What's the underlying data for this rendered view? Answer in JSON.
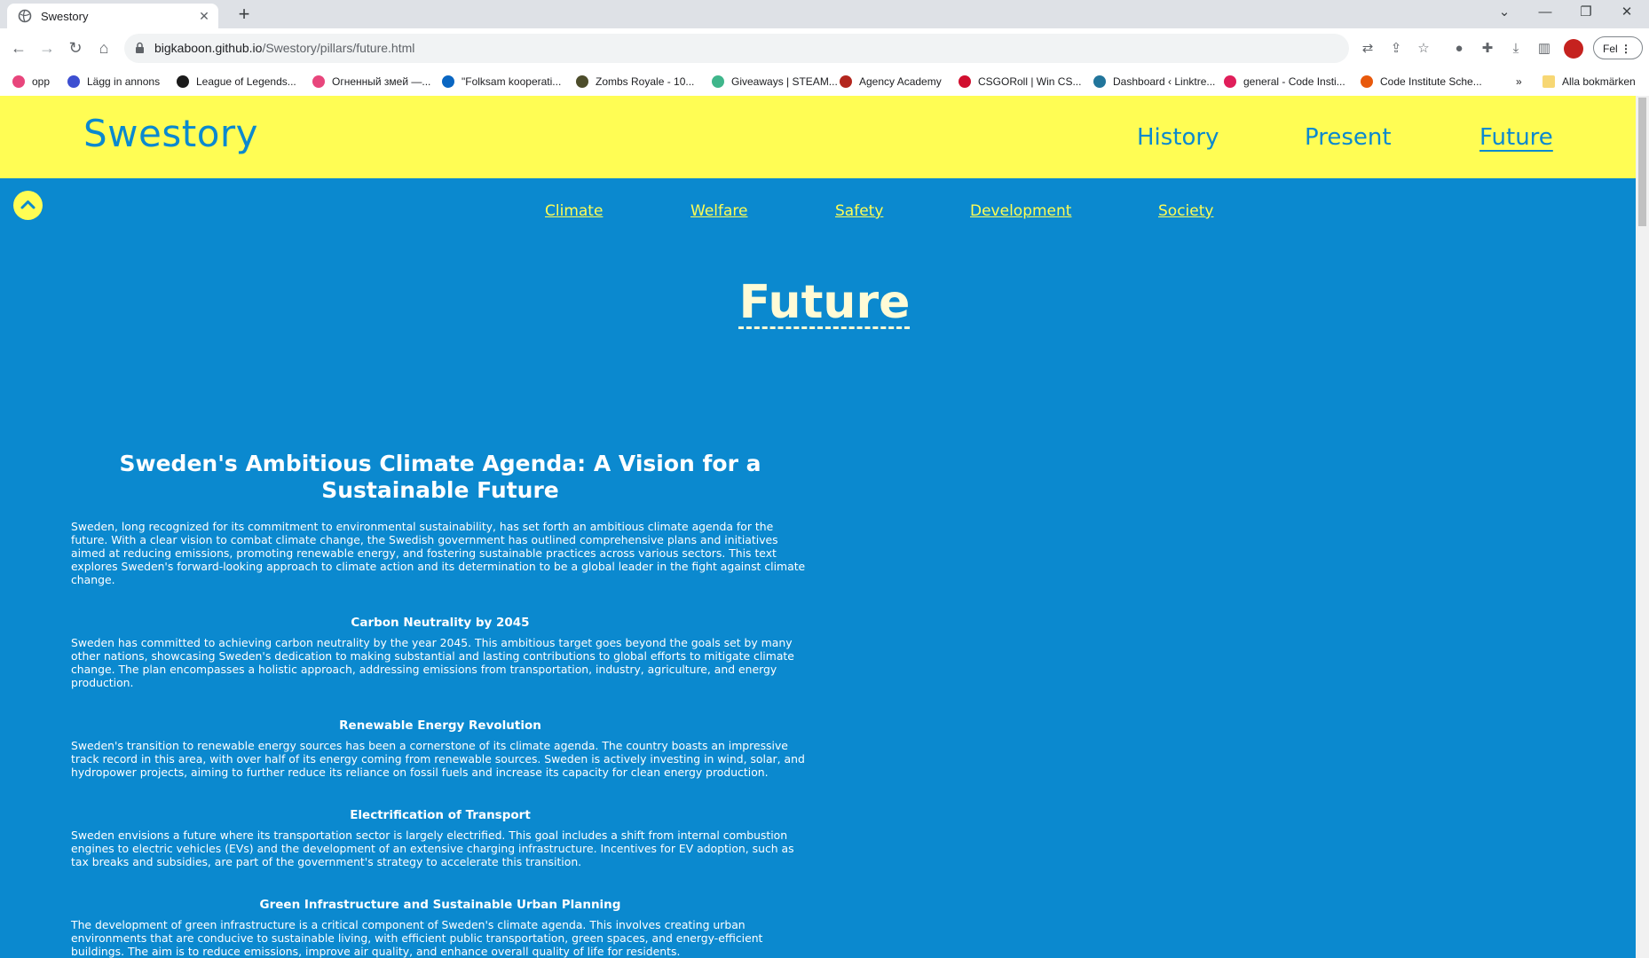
{
  "browser": {
    "tab_title": "Swestory",
    "url_host": "bigkaboon.github.io",
    "url_path": "/Swestory/pillars/future.html",
    "profile_button": "Fel",
    "bookmarks": [
      {
        "label": "opp",
        "icon": "swoosh-icon",
        "color": "#e8467c"
      },
      {
        "label": "Lägg in annons",
        "icon": "circle-s-icon",
        "color": "#3d4fd1"
      },
      {
        "label": "League of Legends...",
        "icon": "lol-icon",
        "color": "#1b1b1b"
      },
      {
        "label": "Огненный змей —...",
        "icon": "swoosh-icon",
        "color": "#e8467c"
      },
      {
        "label": "\"Folksam kooperati...",
        "icon": "linkedin-icon",
        "color": "#0a66c2"
      },
      {
        "label": "Zombs Royale - 10...",
        "icon": "zombs-icon",
        "color": "#4d4d2b"
      },
      {
        "label": "Giveaways | STEAM...",
        "icon": "steam-icon",
        "color": "#3fb68b"
      },
      {
        "label": "Agency Academy",
        "icon": "red-circle-icon",
        "color": "#b3261e"
      },
      {
        "label": "CSGORoll | Win CS...",
        "icon": "csgoroll-icon",
        "color": "#d10f2f"
      },
      {
        "label": "Dashboard ‹ Linktre...",
        "icon": "wordpress-icon",
        "color": "#21759b"
      },
      {
        "label": "general - Code Insti...",
        "icon": "slack-icon",
        "color": "#e01e5a"
      },
      {
        "label": "Code Institute Sche...",
        "icon": "circle-o-icon",
        "color": "#e8590c"
      }
    ],
    "bookmarks_more": "»",
    "all_bookmarks": "Alla bokmärken"
  },
  "site": {
    "brand": "Swestory",
    "nav": [
      "History",
      "Present",
      "Future"
    ],
    "subnav": [
      "Climate",
      "Welfare",
      "Safety",
      "Development",
      "Society"
    ],
    "hero_title": "Future",
    "colors": {
      "primary": "#0b89cf",
      "accent": "#fffd54",
      "hero_text": "#fffbd6"
    }
  },
  "article": {
    "title": "Sweden's Ambitious Climate Agenda: A Vision for a Sustainable Future",
    "intro": "Sweden, long recognized for its commitment to environmental sustainability, has set forth an ambitious climate agenda for the future. With a clear vision to combat climate change, the Swedish government has outlined comprehensive plans and initiatives aimed at reducing emissions, promoting renewable energy, and fostering sustainable practices across various sectors. This text explores Sweden's forward-looking approach to climate action and its determination to be a global leader in the fight against climate change.",
    "sections": [
      {
        "heading": "Carbon Neutrality by 2045",
        "body": "Sweden has committed to achieving carbon neutrality by the year 2045. This ambitious target goes beyond the goals set by many other nations, showcasing Sweden's dedication to making substantial and lasting contributions to global efforts to mitigate climate change. The plan encompasses a holistic approach, addressing emissions from transportation, industry, agriculture, and energy production."
      },
      {
        "heading": "Renewable Energy Revolution",
        "body": "Sweden's transition to renewable energy sources has been a cornerstone of its climate agenda. The country boasts an impressive track record in this area, with over half of its energy coming from renewable sources. Sweden is actively investing in wind, solar, and hydropower projects, aiming to further reduce its reliance on fossil fuels and increase its capacity for clean energy production."
      },
      {
        "heading": "Electrification of Transport",
        "body": "Sweden envisions a future where its transportation sector is largely electrified. This goal includes a shift from internal combustion engines to electric vehicles (EVs) and the development of an extensive charging infrastructure. Incentives for EV adoption, such as tax breaks and subsidies, are part of the government's strategy to accelerate this transition."
      },
      {
        "heading": "Green Infrastructure and Sustainable Urban Planning",
        "body": "The development of green infrastructure is a critical component of Sweden's climate agenda. This involves creating urban environments that are conducive to sustainable living, with efficient public transportation, green spaces, and energy-efficient buildings. The aim is to reduce emissions, improve air quality, and enhance overall quality of life for residents."
      }
    ]
  }
}
